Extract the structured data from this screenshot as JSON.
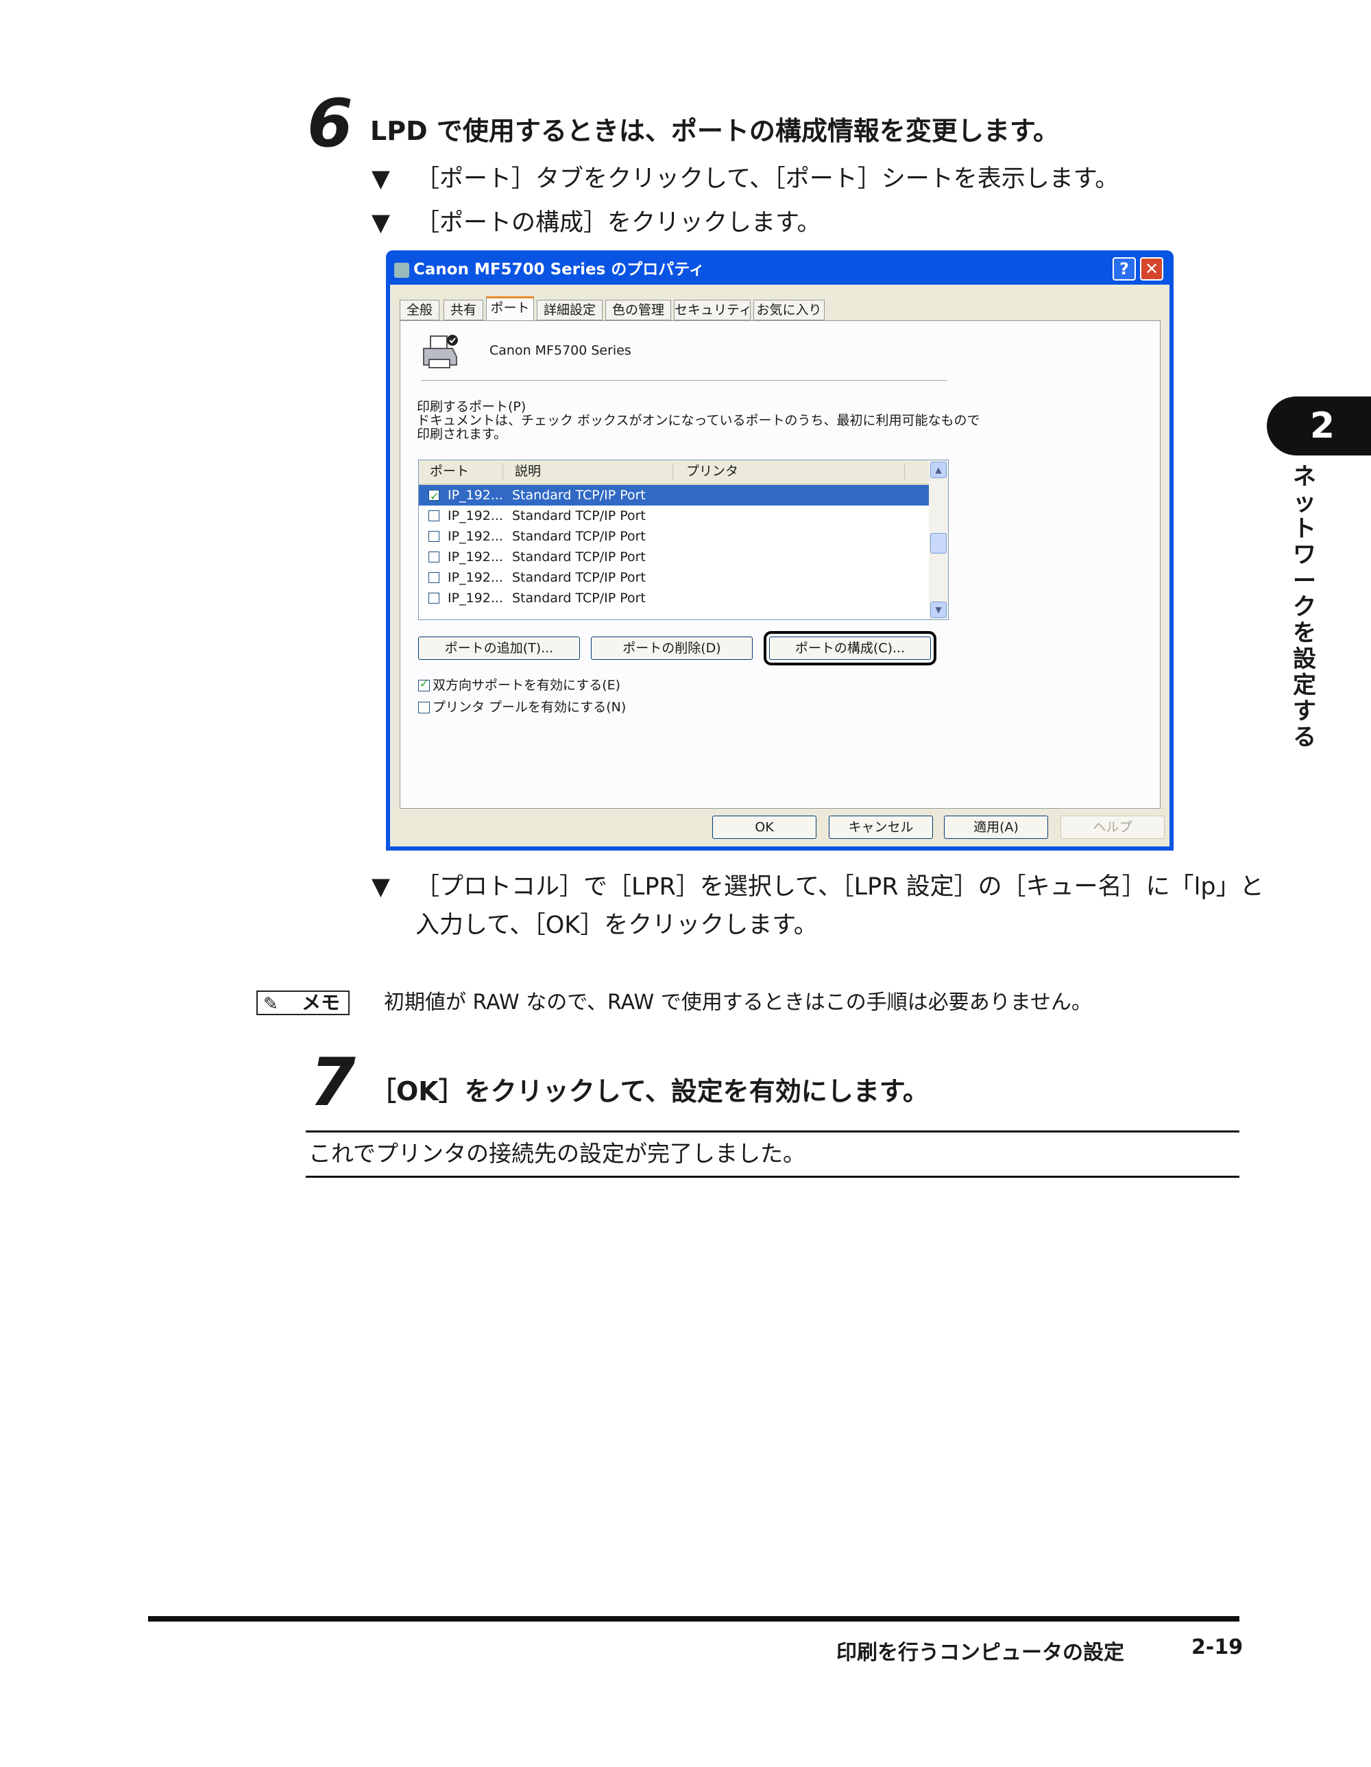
{
  "side_tab": {
    "chapter": "2",
    "text": "ネットワークを設定する"
  },
  "step6": {
    "number": "6",
    "title": "LPD で使用するときは、ポートの構成情報を変更します。",
    "bullets": [
      "［ポート］タブをクリックして、［ポート］シートを表示します。",
      "［ポートの構成］をクリックします。"
    ],
    "bullet_after": [
      "［プロトコル］で［LPR］を選択して、［LPR 設定］の［キュー名］に「lp」と",
      "入力して、［OK］をクリックします。"
    ]
  },
  "dialog": {
    "title": "Canon MF5700 Series のプロパティ",
    "title_buttons": [
      "?",
      "✕"
    ],
    "tabs": [
      "全般",
      "共有",
      "ポート",
      "詳細設定",
      "色の管理",
      "セキュリティ",
      "お気に入り"
    ],
    "active_tab": "ポート",
    "printer_name": "Canon MF5700 Series",
    "port_label": "印刷するポート(P)",
    "port_desc_line1": "ドキュメントは、チェック ボックスがオンになっているポートのうち、最初に利用可能なもので",
    "port_desc_line2": "印刷されます。",
    "columns": [
      "ポート",
      "説明",
      "プリンタ"
    ],
    "rows": [
      {
        "port": "IP_192...",
        "desc": "Standard TCP/IP Port",
        "checked": true,
        "selected": true
      },
      {
        "port": "IP_192...",
        "desc": "Standard TCP/IP Port",
        "checked": false,
        "selected": false
      },
      {
        "port": "IP_192...",
        "desc": "Standard TCP/IP Port",
        "checked": false,
        "selected": false
      },
      {
        "port": "IP_192...",
        "desc": "Standard TCP/IP Port",
        "checked": false,
        "selected": false
      },
      {
        "port": "IP_192...",
        "desc": "Standard TCP/IP Port",
        "checked": false,
        "selected": false
      },
      {
        "port": "IP_192...",
        "desc": "Standard TCP/IP Port",
        "checked": false,
        "selected": false
      }
    ],
    "buttons": {
      "add_port": "ポートの追加(T)...",
      "delete_port": "ポートの削除(D)",
      "configure_port": "ポートの構成(C)..."
    },
    "checkboxes": {
      "bidirectional": {
        "label": "双方向サポートを有効にする(E)",
        "checked": true
      },
      "pool": {
        "label": "プリンタ プールを有効にする(N)",
        "checked": false
      }
    },
    "footer_buttons": {
      "ok": "OK",
      "cancel": "キャンセル",
      "apply": "適用(A)",
      "help": "ヘルプ"
    }
  },
  "memo": {
    "badge": "メモ",
    "text": "初期値が RAW なので、RAW で使用するときはこの手順は必要ありません。"
  },
  "step7": {
    "number": "7",
    "title": "［OK］をクリックして、設定を有効にします。",
    "result": "これでプリンタの接続先の設定が完了しました。"
  },
  "footer": {
    "section_title": "印刷を行うコンピュータの設定",
    "page": "2-19"
  }
}
